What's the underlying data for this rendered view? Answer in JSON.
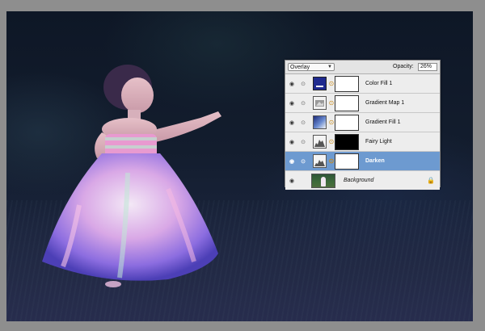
{
  "layers_panel": {
    "blend_mode": "Overlay",
    "opacity_label": "Opacity:",
    "opacity_value": "26%",
    "layers": [
      {
        "name": "Color Fill 1",
        "thumb": "color-fill",
        "mask": "white",
        "selected": false
      },
      {
        "name": "Gradient Map 1",
        "thumb": "gradient-map",
        "mask": "white",
        "selected": false
      },
      {
        "name": "Gradient Fill 1",
        "thumb": "gradient-fill",
        "mask": "white",
        "selected": false
      },
      {
        "name": "Fairy Light",
        "thumb": "levels",
        "mask": "black",
        "selected": false
      },
      {
        "name": "Darken",
        "thumb": "levels",
        "mask": "white",
        "selected": true
      },
      {
        "name": "Background",
        "thumb": "photo",
        "selected": false
      }
    ]
  },
  "colors": {
    "selected_row": "#6d9ad0",
    "color_fill_swatch": "#1f2a8f"
  }
}
